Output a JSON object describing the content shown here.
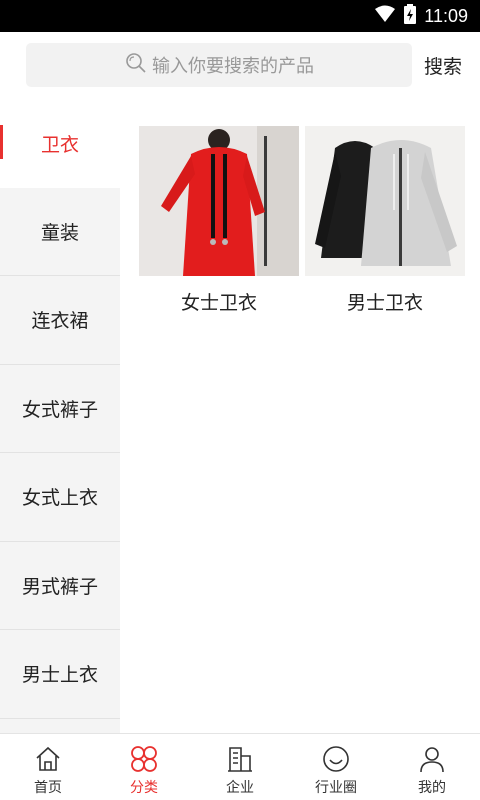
{
  "status_bar": {
    "time": "11:09",
    "icons": [
      "wifi-icon",
      "battery-charging-icon"
    ]
  },
  "search": {
    "placeholder": "输入你要搜索的产品",
    "button_label": "搜索",
    "icon": "search-icon"
  },
  "sidebar": {
    "items": [
      {
        "label": "卫衣",
        "active": true
      },
      {
        "label": "童装"
      },
      {
        "label": "连衣裙"
      },
      {
        "label": "女式裤子"
      },
      {
        "label": "女式上衣"
      },
      {
        "label": "男式裤子"
      },
      {
        "label": "男士上衣"
      }
    ]
  },
  "products": [
    {
      "name": "女士卫衣"
    },
    {
      "name": "男士卫衣"
    }
  ],
  "tab_bar": {
    "tabs": [
      {
        "label": "首页",
        "icon": "home-icon"
      },
      {
        "label": "分类",
        "icon": "category-icon",
        "active": true
      },
      {
        "label": "企业",
        "icon": "building-icon"
      },
      {
        "label": "行业圈",
        "icon": "smile-icon"
      },
      {
        "label": "我的",
        "icon": "user-icon"
      }
    ]
  },
  "colors": {
    "accent": "#e8312f",
    "sidebar_bg": "#f4f4f4",
    "search_bg": "#f2f2f2"
  }
}
